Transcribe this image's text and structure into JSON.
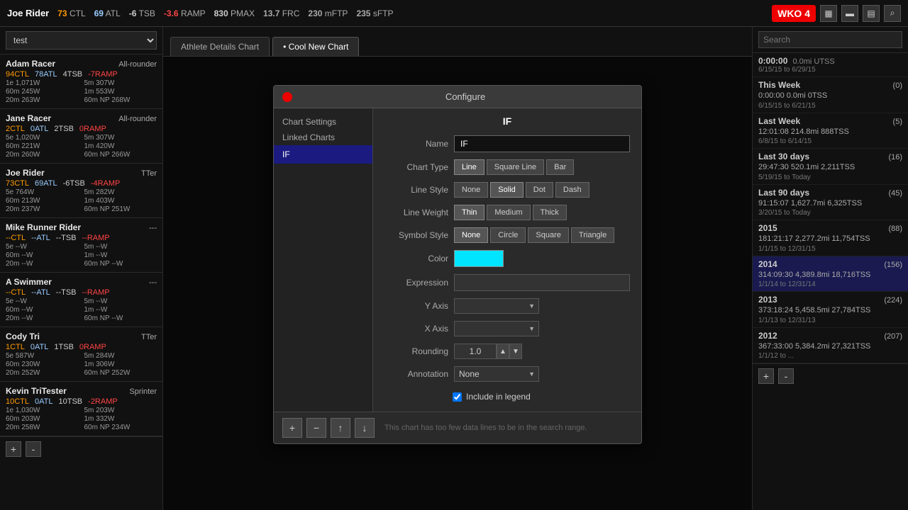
{
  "topbar": {
    "athlete": "Joe Rider",
    "stats": [
      {
        "label": "CTL",
        "value": "73",
        "class": "stat-ctl"
      },
      {
        "label": "ATL",
        "value": "69",
        "class": "stat-atl"
      },
      {
        "label": "TSB",
        "value": "-6",
        "class": "stat-tsb"
      },
      {
        "label": "RAMP",
        "value": "-3.6",
        "class": "stat-ramp"
      },
      {
        "label": "PMAX",
        "value": "830",
        "class": "stat-pmax"
      },
      {
        "label": "FRC",
        "value": "13.7",
        "class": "stat-frc"
      },
      {
        "label": "mFTP",
        "value": "230",
        "class": "stat-mftp"
      },
      {
        "label": "sFTP",
        "value": "235",
        "class": "stat-sftp"
      }
    ],
    "wko_label": "WKO 4"
  },
  "left_panel": {
    "dropdown_value": "test",
    "athletes": [
      {
        "name": "Adam Racer",
        "type": "All-rounder",
        "ctl": "94",
        "atl": "78",
        "tsb": "4",
        "ramp": "-7",
        "metrics": [
          "1e 1,071W",
          "5m 307W",
          "60m 245W",
          "1m 553W",
          "20m 263W",
          "60m NP 268W"
        ]
      },
      {
        "name": "Jane Racer",
        "type": "All-rounder",
        "ctl": "2",
        "atl": "0",
        "tsb": "2",
        "ramp": "0",
        "metrics": [
          "5e 1,020W",
          "5m 307W",
          "60m 221W",
          "1m 420W",
          "20m 260W",
          "60m NP 266W"
        ]
      },
      {
        "name": "Joe Rider",
        "type": "TTer",
        "ctl": "73",
        "atl": "69",
        "tsb": "-6",
        "ramp": "-4",
        "metrics": [
          "5e 764W",
          "5m 282W",
          "60m 213W",
          "1m 403W",
          "20m 237W",
          "60m NP 251W"
        ]
      },
      {
        "name": "Mike Runner Rider",
        "type": "---",
        "ctl": "--",
        "atl": "--",
        "tsb": "--",
        "ramp": "--",
        "metrics": [
          "5e --W",
          "5m --W",
          "60m --W",
          "1m --W",
          "20m --W",
          "60m NP --W"
        ]
      },
      {
        "name": "A Swimmer",
        "type": "---",
        "ctl": "--",
        "atl": "--",
        "tsb": "--",
        "ramp": "--",
        "metrics": [
          "5e --W",
          "5m --W",
          "60m --W",
          "1m --W",
          "20m --W",
          "60m NP --W"
        ]
      },
      {
        "name": "Cody Tri",
        "type": "TTer",
        "ctl": "1",
        "atl": "0",
        "tsb": "1",
        "ramp": "0",
        "metrics": [
          "5e 587W",
          "5m 284W",
          "60m 230W",
          "1m 306W",
          "20m 252W",
          "60m NP 252W"
        ]
      },
      {
        "name": "Kevin TriTester",
        "type": "Sprinter",
        "ctl": "10",
        "atl": "0",
        "tsb": "10",
        "ramp": "-2",
        "metrics": [
          "1e 1,030W",
          "5m 203W",
          "60m 203W",
          "1m 332W",
          "20m 258W",
          "60m NP 234W"
        ]
      }
    ],
    "add_label": "+",
    "remove_label": "-"
  },
  "tabs": [
    {
      "label": "Athlete Details Chart",
      "active": false
    },
    {
      "label": "• Cool New Chart",
      "active": true
    }
  ],
  "modal": {
    "title": "Configure",
    "sidebar_items": [
      {
        "label": "Chart Settings",
        "active": false
      },
      {
        "label": "Linked Charts",
        "active": false
      },
      {
        "label": "IF",
        "active": true
      }
    ],
    "section_title": "IF",
    "name_value": "IF",
    "name_placeholder": "IF",
    "chart_types": [
      {
        "label": "Line",
        "active": true
      },
      {
        "label": "Square Line",
        "active": false
      },
      {
        "label": "Bar",
        "active": false
      }
    ],
    "line_styles": [
      {
        "label": "None",
        "active": false
      },
      {
        "label": "Solid",
        "active": true
      },
      {
        "label": "Dot",
        "active": false
      },
      {
        "label": "Dash",
        "active": false
      }
    ],
    "line_weights": [
      {
        "label": "Thin",
        "active": true
      },
      {
        "label": "Medium",
        "active": false
      },
      {
        "label": "Thick",
        "active": false
      }
    ],
    "symbol_styles": [
      {
        "label": "None",
        "active": true
      },
      {
        "label": "Circle",
        "active": false
      },
      {
        "label": "Square",
        "active": false
      },
      {
        "label": "Triangle",
        "active": false
      }
    ],
    "color_value": "#00e5ff",
    "expression_value": "",
    "y_axis_value": "",
    "x_axis_value": "",
    "rounding_value": "1.0",
    "annotation_value": "None",
    "include_legend": true,
    "include_legend_label": "Include in legend",
    "footer_buttons": [
      {
        "icon": "+",
        "name": "add-series-btn"
      },
      {
        "icon": "−",
        "name": "remove-series-btn"
      },
      {
        "icon": "↑",
        "name": "move-up-btn"
      },
      {
        "icon": "↓",
        "name": "move-down-btn"
      }
    ],
    "hint_text": "This chart has too few data lines to be in the search range."
  },
  "right_panel": {
    "search_placeholder": "Search",
    "summary_rows": [
      {
        "label": "0:00:00",
        "extra": "0.0mi UTSS",
        "dates": "6/15/15 to 6/29/15"
      },
      {
        "label": "This Week",
        "count": "(0)",
        "metrics": "0:00:00  0.0mi  0TSS",
        "dates": "6/15/15 to 6/21/15"
      },
      {
        "label": "Last Week",
        "count": "(5)",
        "metrics": "12:01:08  214.8mi  888TSS",
        "dates": "6/8/15 to 6/14/15"
      },
      {
        "label": "Last 30 days",
        "count": "(16)",
        "metrics": "29:47:30  520.1mi  2,211TSS",
        "dates": "5/19/15 to Today"
      },
      {
        "label": "Last 90 days",
        "count": "(45)",
        "metrics": "91:15:07  1,627.7mi  6,325TSS",
        "dates": "3/20/15 to Today"
      },
      {
        "label": "2015",
        "count": "(88)",
        "metrics": "181:21:17  2,277.2mi  11,754TSS",
        "dates": "1/1/15 to 12/31/15"
      },
      {
        "label": "2014",
        "count": "(156)",
        "metrics": "314:09:30  4,389.8mi  18,716TSS",
        "dates": "1/1/14 to 12/31/14",
        "highlighted": true
      },
      {
        "label": "2013",
        "count": "(224)",
        "metrics": "373:18:24  5,458.5mi  27,784TSS",
        "dates": "1/1/13 to 12/31/13"
      },
      {
        "label": "2012",
        "count": "(207)",
        "metrics": "367:33:00  5,384.2mi  27,321TSS",
        "dates": "1/1/12 to ..."
      }
    ],
    "add_label": "+",
    "remove_label": "-"
  }
}
